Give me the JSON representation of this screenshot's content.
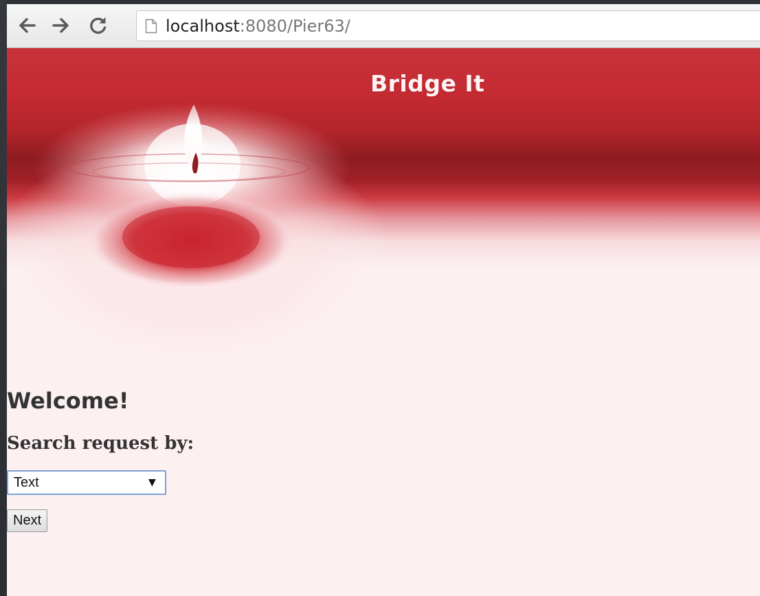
{
  "browser": {
    "nav": {
      "back_icon": "arrow-left-icon",
      "forward_icon": "arrow-right-icon",
      "reload_icon": "reload-icon",
      "page_icon": "document-icon"
    },
    "url_host": "localhost",
    "url_rest": ":8080/Pier63/"
  },
  "page": {
    "site_title": "Bridge It",
    "banner_image": "candle-image",
    "welcome": "Welcome!",
    "search_label": "Search request by:",
    "search_select": {
      "selected": "Text",
      "arrow_icon": "dropdown-arrow-icon"
    },
    "next_button": "Next"
  },
  "colors": {
    "banner_red": "#c62c33",
    "banner_dark_red": "#8e1c22",
    "page_background": "#fcf0f1",
    "title_text": "#fff3f4",
    "body_text": "#333333",
    "select_border": "#7d9fd3"
  }
}
